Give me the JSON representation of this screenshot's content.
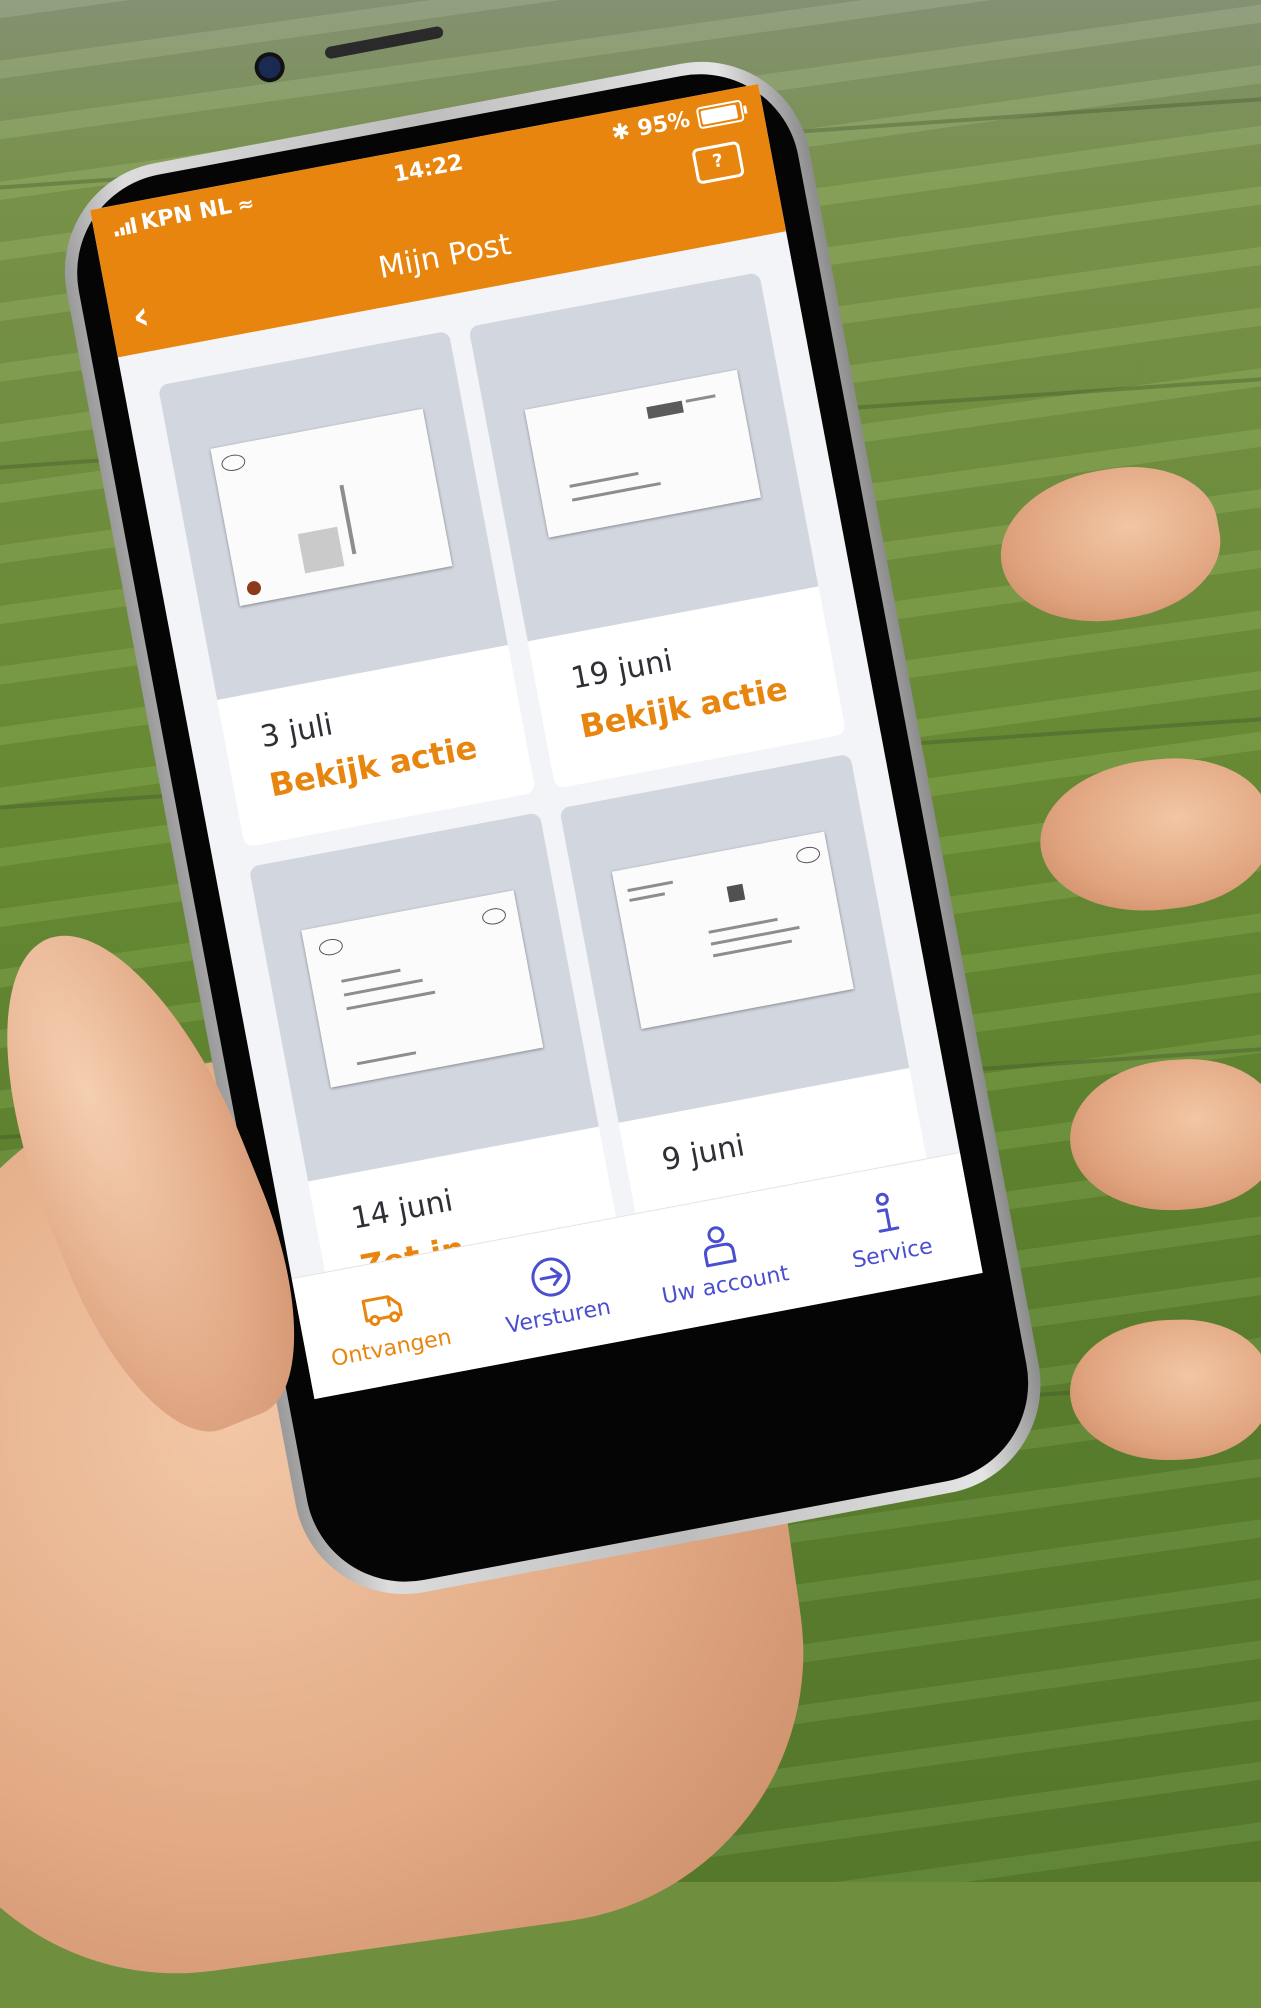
{
  "status_bar": {
    "carrier": "KPN NL",
    "time": "14:22",
    "battery": "95%",
    "battery_level": 0.95
  },
  "header": {
    "title": "Mijn Post",
    "back_icon": "chevron-left-icon",
    "help_icon": "help-chat-icon"
  },
  "cards": [
    {
      "date": "3 juli",
      "action": "Bekijk actie"
    },
    {
      "date": "19 juni",
      "action": "Bekijk actie"
    },
    {
      "date": "14 juni",
      "action": "Zet in agenda"
    },
    {
      "date": "9 juni",
      "action": ""
    }
  ],
  "tabbar": {
    "items": [
      {
        "label": "Ontvangen",
        "icon": "van-icon",
        "active": true
      },
      {
        "label": "Versturen",
        "icon": "arrow-circle-icon",
        "active": false
      },
      {
        "label": "Uw account",
        "icon": "user-icon",
        "active": false
      },
      {
        "label": "Service",
        "icon": "info-icon",
        "active": false
      }
    ]
  },
  "colors": {
    "accent": "#e8850e",
    "tab_inactive": "#4a4fd0",
    "thumb_bg": "#d2d6df",
    "screen_bg": "#f3f4f7"
  }
}
